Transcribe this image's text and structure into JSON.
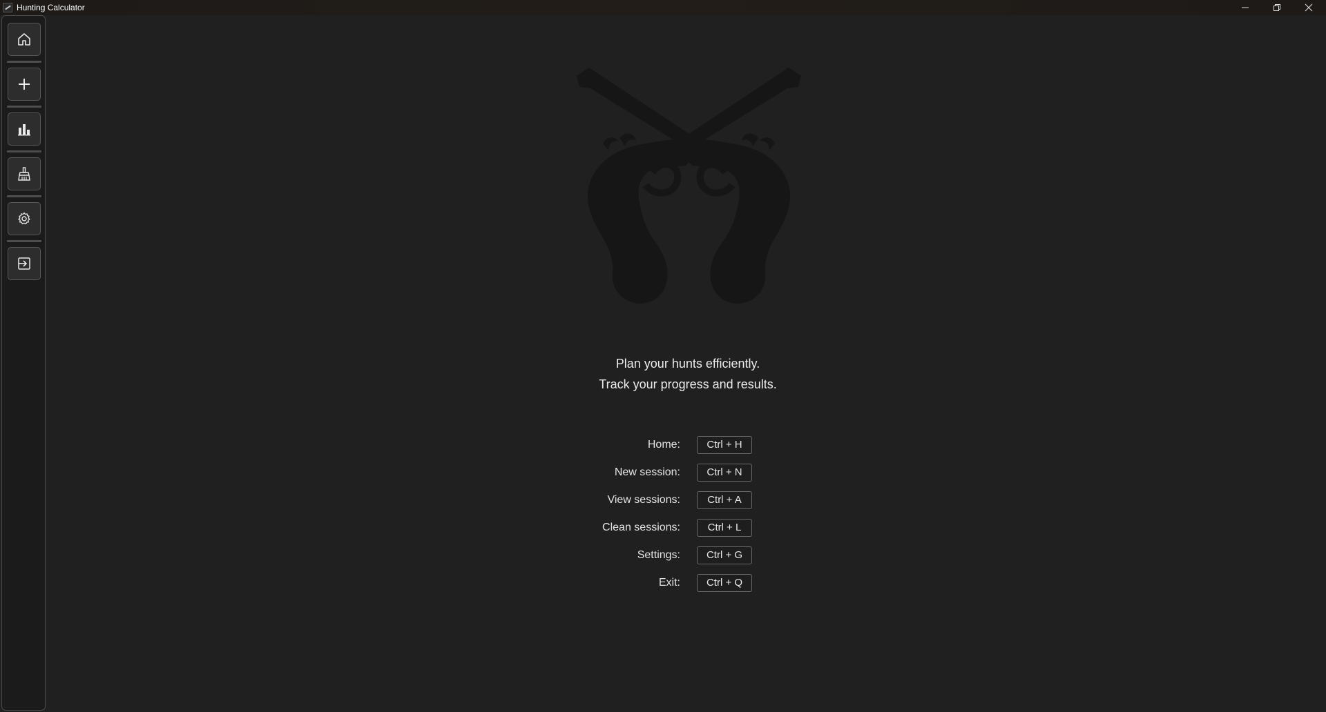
{
  "window": {
    "title": "Hunting Calculator",
    "controls": [
      "minimize",
      "restore",
      "close"
    ]
  },
  "sidebar": {
    "items": [
      {
        "name": "home",
        "icon": "home-icon"
      },
      {
        "name": "new-session",
        "icon": "plus-icon"
      },
      {
        "name": "view-sessions",
        "icon": "bar-chart-icon"
      },
      {
        "name": "clean-sessions",
        "icon": "broom-icon"
      },
      {
        "name": "settings",
        "icon": "gear-icon"
      },
      {
        "name": "exit",
        "icon": "exit-icon"
      }
    ]
  },
  "main": {
    "hero_icon": "crossed-pistols-icon",
    "tagline": {
      "line1": "Plan your hunts efficiently.",
      "line2": "Track your progress and results."
    },
    "shortcuts": [
      {
        "label": "Home:",
        "keys": "Ctrl + H"
      },
      {
        "label": "New session:",
        "keys": "Ctrl + N"
      },
      {
        "label": "View sessions:",
        "keys": "Ctrl + A"
      },
      {
        "label": "Clean sessions:",
        "keys": "Ctrl + L"
      },
      {
        "label": "Settings:",
        "keys": "Ctrl + G"
      },
      {
        "label": "Exit:",
        "keys": "Ctrl + Q"
      }
    ]
  },
  "colors": {
    "background": "#202020",
    "sidebar_button": "#2d2d2d",
    "hero_silhouette": "#151515",
    "text": "#ececec"
  }
}
